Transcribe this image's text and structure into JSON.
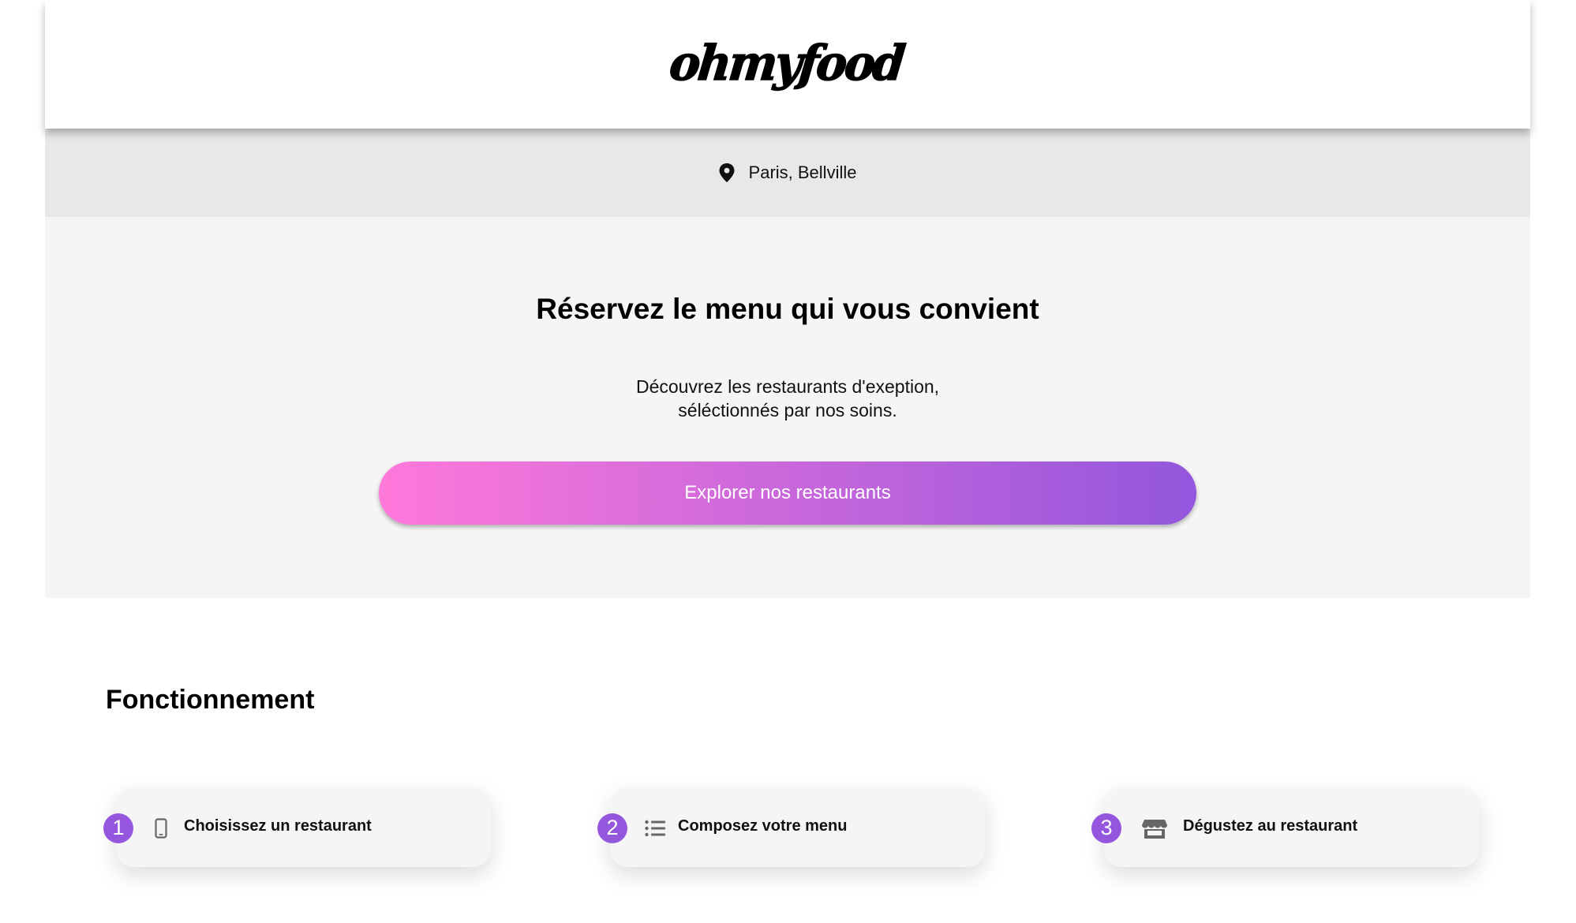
{
  "header": {
    "logo_text": "ohmyfood"
  },
  "location": {
    "icon": "map-pin-icon",
    "text": "Paris, Bellville"
  },
  "hero": {
    "title": "Réservez le menu qui vous convient",
    "subtitle_line1": "Découvrez les restaurants d'exeption,",
    "subtitle_line2": "séléctionnés par nos soins.",
    "cta_label": "Explorer nos restaurants",
    "gradient_start": "#ff79da",
    "gradient_end": "#9356dc"
  },
  "how_it_works": {
    "title": "Fonctionnement",
    "accent": "#9356dc",
    "steps": [
      {
        "number": "1",
        "icon": "mobile-phone-icon",
        "label": "Choisissez un restaurant"
      },
      {
        "number": "2",
        "icon": "list-icon",
        "label": "Composez votre menu"
      },
      {
        "number": "3",
        "icon": "store-icon",
        "label": "Dégustez au restaurant"
      }
    ]
  }
}
